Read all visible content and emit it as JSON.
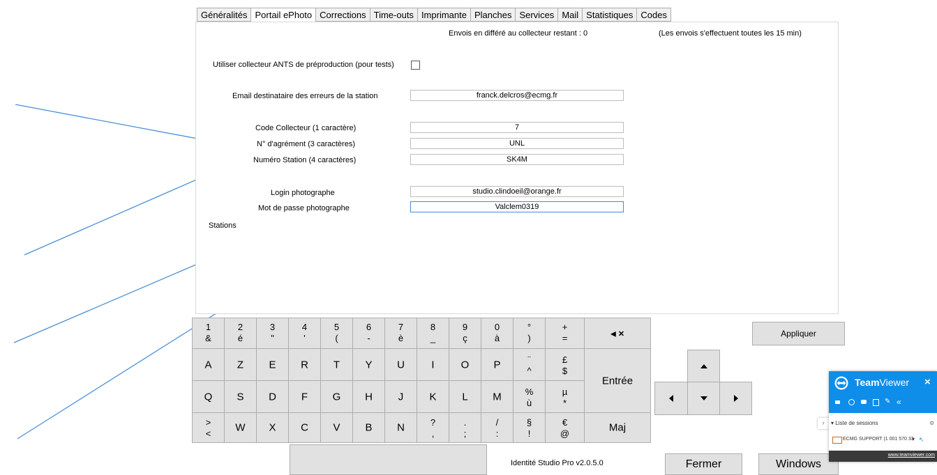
{
  "tabs": [
    "Généralités",
    "Portail ePhoto",
    "Corrections",
    "Time-outs",
    "Imprimante",
    "Planches",
    "Services",
    "Mail",
    "Statistiques",
    "Codes"
  ],
  "active_tab": "Portail ePhoto",
  "panel": {
    "pending_text": "Envois en différé au collecteur restant : 0",
    "interval_text": "(Les envois s'effectuent toutes les 15 min)",
    "ants_label": "Utiliser collecteur ANTS de préproduction (pour tests)",
    "ants_checked": false,
    "email_label": "Email destinataire des erreurs de la station",
    "email_value": "franck.delcros@ecmg.fr",
    "code_label": "Code Collecteur (1 caractère)",
    "code_value": "7",
    "agrement_label": "N° d'agrément (3 caractères)",
    "agrement_value": "UNL",
    "station_label": "Numéro Station (4 caractères)",
    "station_value": "SK4M",
    "login_label": "Login photographe",
    "login_value": "studio.clindoeil@orange.fr",
    "password_label": "Mot de passe photographe",
    "password_value": "Valclem0319",
    "stations_label": "Stations"
  },
  "keyboard": {
    "row1": [
      [
        "1",
        "&"
      ],
      [
        "2",
        "é"
      ],
      [
        "3",
        "\""
      ],
      [
        "4",
        "'"
      ],
      [
        "5",
        "("
      ],
      [
        "6",
        "-"
      ],
      [
        "7",
        "è"
      ],
      [
        "8",
        "_"
      ],
      [
        "9",
        "ç"
      ],
      [
        "0",
        "à"
      ],
      [
        "°",
        ")"
      ],
      [
        "+",
        "="
      ]
    ],
    "backspace": "◂ ×",
    "row2": [
      "A",
      "Z",
      "E",
      "R",
      "T",
      "Y",
      "U",
      "I",
      "O",
      "P"
    ],
    "row2_extra": [
      [
        "¨",
        "^"
      ],
      [
        "£",
        "$"
      ]
    ],
    "enter": "Entrée",
    "row3": [
      "Q",
      "S",
      "D",
      "F",
      "G",
      "H",
      "J",
      "K",
      "L",
      "M"
    ],
    "row3_extra": [
      [
        "%",
        "ù"
      ],
      [
        "µ",
        "*"
      ]
    ],
    "row4_first": [
      ">",
      "<"
    ],
    "row4": [
      "W",
      "X",
      "C",
      "V",
      "B",
      "N"
    ],
    "row4_extra": [
      [
        "?",
        ","
      ],
      [
        ".",
        ";"
      ],
      [
        "/",
        ":"
      ],
      [
        "§",
        "!"
      ],
      [
        "€",
        "@"
      ]
    ],
    "shift": "Maj"
  },
  "buttons": {
    "apply": "Appliquer",
    "close": "Fermer",
    "windows": "Windows"
  },
  "version": "Identité Studio Pro  v2.0.5.0",
  "teamviewer": {
    "brand_bold": "Team",
    "brand_light": "Viewer",
    "close": "×",
    "sessions_label": "▾ Liste de sessions",
    "session_item": "ECMG SUPPORT (1 001 570 33",
    "link": "www.teamviewer.com"
  },
  "colors": {
    "arrow_blue": "#4a90d9",
    "teamviewer_blue": "#0e8ee9",
    "key_gray": "#e1e1e1",
    "focus_border": "#3c8fd6"
  }
}
